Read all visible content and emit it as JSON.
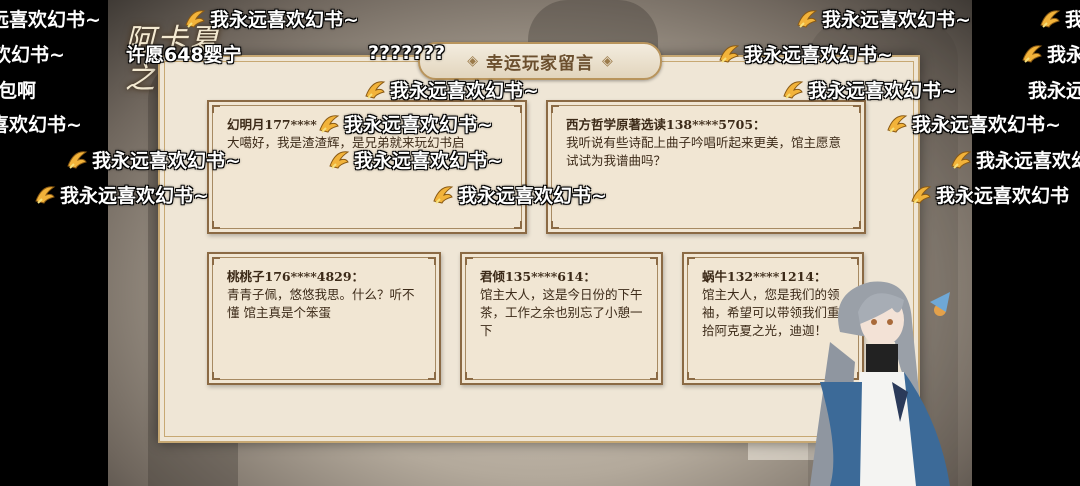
{
  "scene": {
    "game_logo": "阿卡夏之夜",
    "board_title": "幸运玩家留言",
    "messages": [
      {
        "author": "幻明月177****",
        "text": "大噶好，我是渣渣辉，是兄弟就来玩幻书启"
      },
      {
        "author": "西方哲学原著选读138****5705：",
        "text": "我听说有些诗配上曲子吟唱听起来更美，馆主愿意试试为我谱曲吗？"
      },
      {
        "author": "桃桃子176****4829：",
        "text": "青青子佩，悠悠我思。什么？听不懂 馆主真是个笨蛋"
      },
      {
        "author": "君倾135****614：",
        "text": "馆主大人，这是今日份的下午茶，工作之余也别忘了小憩一下"
      },
      {
        "author": "蜗牛132****1214：",
        "text": "馆主大人，您是我们的领袖，希望可以带领我们重拾阿克夏之光，迪迦！"
      }
    ]
  },
  "danmaku": [
    {
      "text": "我永远喜欢幻书~",
      "icon": "gift-icon"
    },
    {
      "text": "我永远喜欢幻书~",
      "icon": "gift-icon"
    },
    {
      "text": "我永远喜欢幻书~",
      "icon": "gift-icon"
    },
    {
      "text": "我永远喜欢幻书~",
      "icon": "gift-icon"
    },
    {
      "text": "我永远喜欢幻书~",
      "icon": ""
    },
    {
      "text": "许愿648婴宁",
      "icon": ""
    },
    {
      "text": "???????",
      "icon": ""
    },
    {
      "text": "我永远喜欢幻书~",
      "icon": "gift-icon"
    },
    {
      "text": "我永",
      "icon": "gift-icon"
    },
    {
      "text": "包啊",
      "icon": ""
    },
    {
      "text": "我永远喜欢幻书~",
      "icon": "gift-icon"
    },
    {
      "text": "我永远喜欢幻书~",
      "icon": "gift-icon"
    },
    {
      "text": "我永远",
      "icon": ""
    },
    {
      "text": "喜欢幻书~",
      "icon": ""
    },
    {
      "text": "我永远喜欢幻书~",
      "icon": "gift-icon"
    },
    {
      "text": "我永远喜欢幻书~",
      "icon": "gift-icon"
    },
    {
      "text": "我永远喜欢幻书~",
      "icon": "gift-icon"
    },
    {
      "text": "我永远喜欢幻书~",
      "icon": "gift-icon"
    },
    {
      "text": "我永远喜欢幻书",
      "icon": "gift-icon"
    },
    {
      "text": "我永远喜欢幻书~",
      "icon": "gift-icon"
    },
    {
      "text": "我永远喜欢幻书~",
      "icon": "gift-icon"
    },
    {
      "text": "我永远喜欢幻书",
      "icon": "gift-icon"
    },
    {
      "text": "欢幻书~",
      "icon": ""
    },
    {
      "text": "远喜欢幻书~",
      "icon": ""
    }
  ],
  "colors": {
    "danmaku_text": "#ffffff",
    "board_bg": "#efe6d6",
    "card_border": "#8b6a44",
    "title_text": "#6b4f2e"
  }
}
